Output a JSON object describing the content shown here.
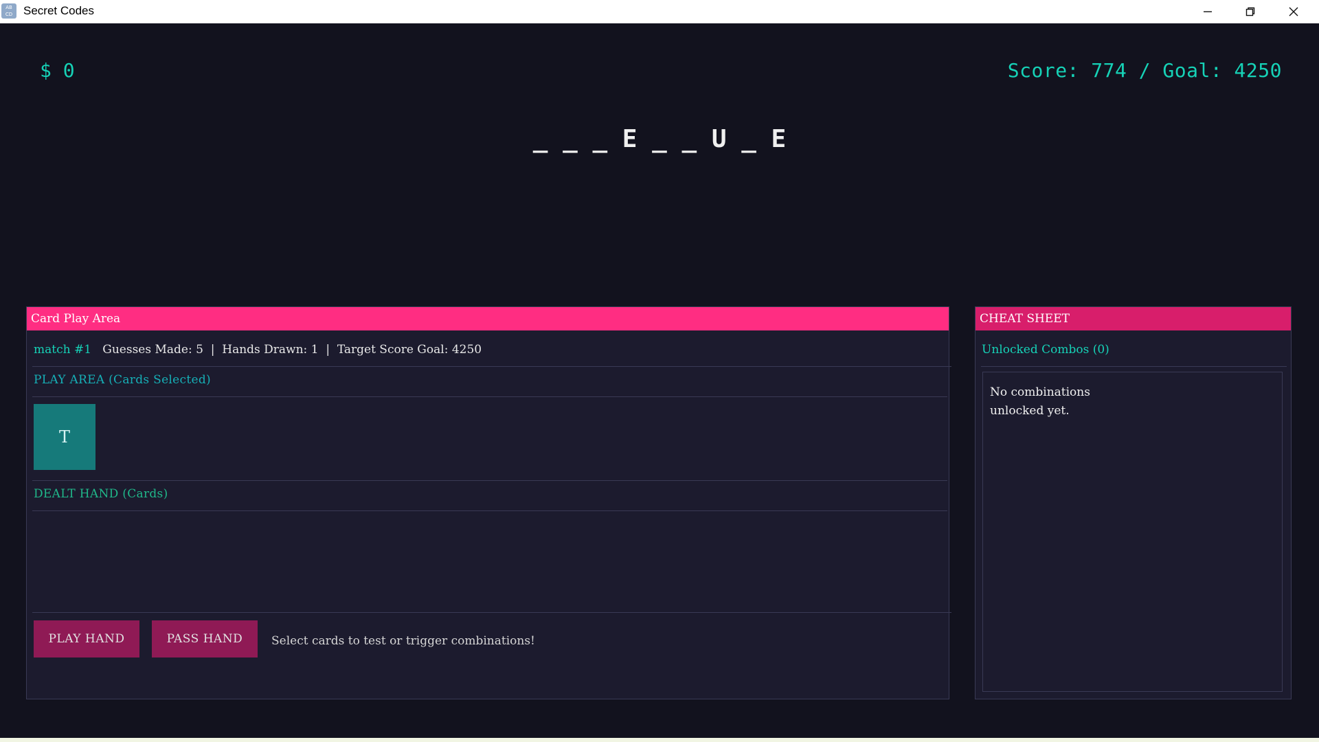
{
  "window": {
    "title": "Secret Codes",
    "icon_text": "AB CD"
  },
  "hud": {
    "money": "$ 0",
    "score": "Score: 774 / Goal: 4250"
  },
  "secret_word": "_ _ _ E _ _ U _ E",
  "card_panel": {
    "header": "Card Play Area",
    "match_label": "match #1",
    "stats": "Guesses Made: 5  |  Hands Drawn: 1  |  Target Score Goal: 4250",
    "play_area_label": "PLAY AREA (Cards Selected)",
    "selected_cards": [
      "T"
    ],
    "dealt_hand_label": "DEALT HAND (Cards)",
    "play_button": "PLAY HAND",
    "pass_button": "PASS HAND",
    "hint": "Select cards to test or trigger combinations!"
  },
  "cheat_sheet": {
    "header": "CHEAT SHEET",
    "combos_title": "Unlocked Combos (0)",
    "empty_text": "No combinations unlocked yet."
  },
  "colors": {
    "background": "#12121e",
    "panel": "#1c1b2e",
    "accent_teal": "#16d2b7",
    "header_pink": "#ff2d82",
    "button_magenta": "#8f1a55",
    "card_teal": "#167a7a"
  }
}
